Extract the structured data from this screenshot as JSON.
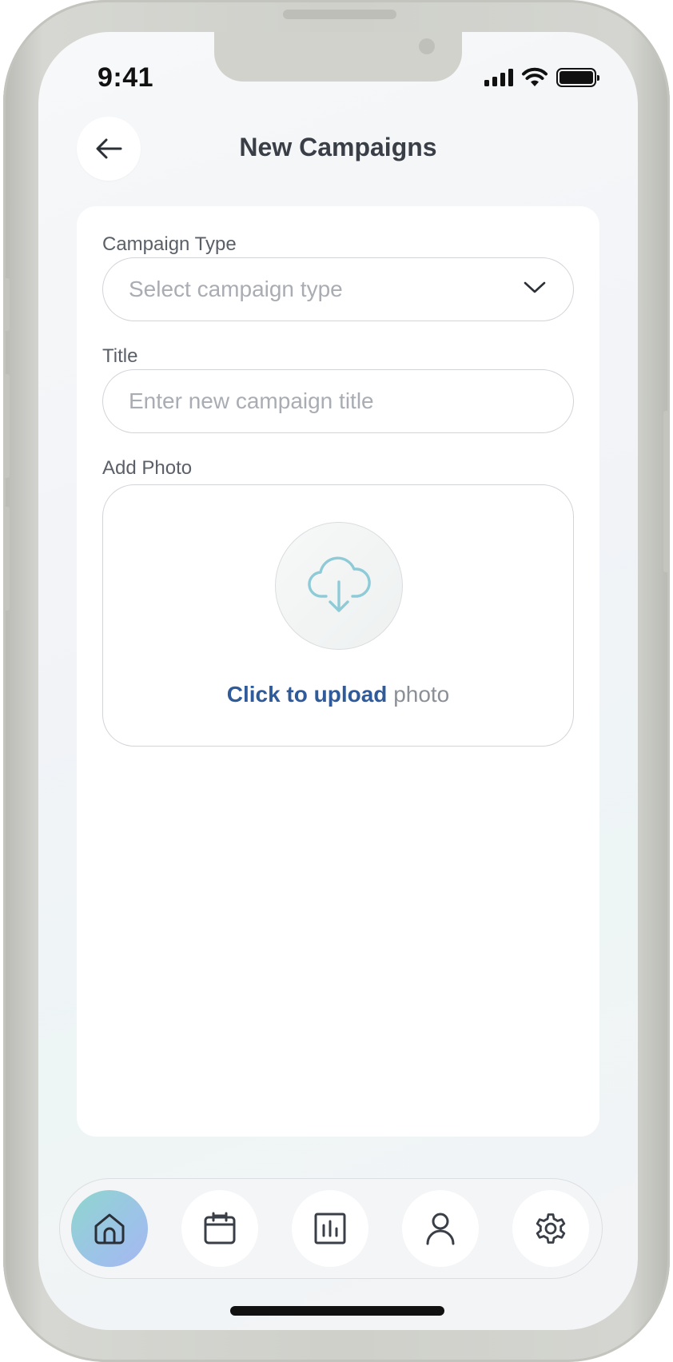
{
  "status_bar": {
    "time": "9:41"
  },
  "header": {
    "title": "New Campaigns"
  },
  "form": {
    "campaign_type": {
      "label": "Campaign Type",
      "placeholder": "Select campaign type"
    },
    "title": {
      "label": "Title",
      "placeholder": "Enter new campaign title"
    },
    "photo": {
      "label": "Add Photo",
      "upload_link": "Click to upload",
      "upload_suffix": "photo"
    }
  },
  "bottom_nav": {
    "items": [
      {
        "icon": "home-icon",
        "active": true
      },
      {
        "icon": "calendar-icon",
        "active": false
      },
      {
        "icon": "chart-icon",
        "active": false
      },
      {
        "icon": "user-icon",
        "active": false
      },
      {
        "icon": "gear-icon",
        "active": false
      }
    ]
  },
  "colors": {
    "accent_link": "#2f5b9a",
    "upload_icon": "#8fcbd6",
    "active_nav_gradient_start": "#8fd6cd",
    "active_nav_gradient_end": "#a7b7f0"
  }
}
